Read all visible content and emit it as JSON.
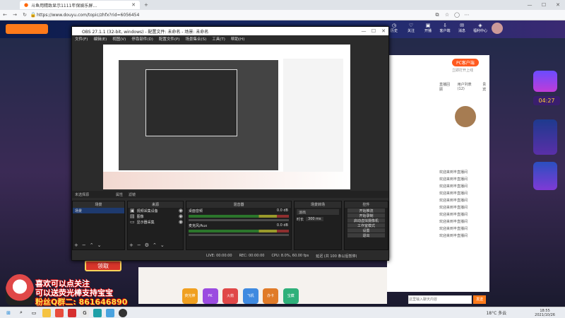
{
  "browser": {
    "tab_title": "斗鱼用精致显示1111年保娱乐屏...",
    "address": "https://www.douyu.com/topic/zhfx?rid=6056454",
    "new_tab_glyph": "+"
  },
  "site_nav": {
    "items": [
      "历史",
      "关注",
      "开播",
      "客户端",
      "消息",
      "福利中心"
    ],
    "pc_client_label": "PC客户端",
    "pc_client_sub": "立即打开上线"
  },
  "obs": {
    "title": "OBS 27.1.1 (32-bit, windows) - 配置文件: 未命名 - 场景: 未命名",
    "menu": [
      "文件(F)",
      "编辑(E)",
      "视图(V)",
      "停靠部件(D)",
      "配置文件(P)",
      "场景集合(S)",
      "工具(T)",
      "帮助(H)"
    ],
    "source_bar": [
      "未选择源",
      "属性",
      "滤镜"
    ],
    "docks": {
      "scenes": {
        "title": "场景",
        "items": [
          "场景"
        ]
      },
      "sources": {
        "title": "来源",
        "items": [
          "视频采集设备",
          "图像",
          "显示器采集"
        ]
      },
      "mixer": {
        "title": "混音器",
        "tracks": [
          {
            "name": "桌面音频",
            "level": "0.0 dB"
          },
          {
            "name": "麦克风/Aux",
            "level": "0.0 dB"
          }
        ]
      },
      "transitions": {
        "title": "场景转场",
        "type": "淡出",
        "duration_label": "时长",
        "duration": "300 ms"
      },
      "controls": {
        "title": "控件",
        "buttons": [
          "开始推流",
          "开始录制",
          "启动虚拟摄像机",
          "工作室模式",
          "设置",
          "退出"
        ]
      }
    },
    "status": {
      "live": "LIVE: 00:00:00",
      "rec": "REC: 00:00:00",
      "cpu": "CPU: 8.0%, 60.00 fps",
      "reconnect": "延迟 (共 100 条以后暂停)"
    }
  },
  "right_panel": {
    "tabs": [
      "直播回顾",
      "用户列表(12)",
      "贵宾"
    ],
    "time": "04:27",
    "chat": [
      "欢迎来到丰直播间",
      "欢迎来到丰直播间",
      "欢迎来到丰直播间",
      "欢迎来到丰直播间",
      "欢迎来到丰直播间",
      "欢迎来到丰直播间",
      "欢迎来到丰直播间",
      "欢迎来到丰直播间",
      "欢迎来到丰直播间",
      "欢迎来到丰直播间"
    ],
    "chat_input_placeholder": "这里输入聊天内容",
    "send_label": "发送"
  },
  "overlay": {
    "line1": "喜欢可以点关注",
    "line2": "可以送荧光棒支持宝宝",
    "line3": "粉丝Q群二: 861646890"
  },
  "promo_label": "领取",
  "gifts": [
    "荧光棒",
    "PK",
    "火箭",
    "飞机",
    "办卡",
    "宝藏"
  ],
  "taskbar": {
    "weather": "18°C 多云",
    "time": "18:55",
    "date": "2021/10/26"
  }
}
